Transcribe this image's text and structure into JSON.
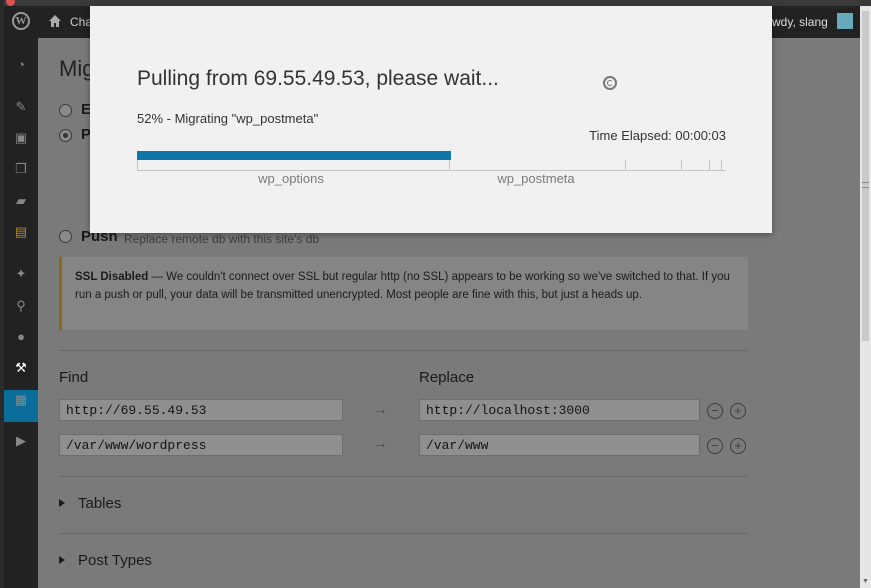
{
  "admin_bar": {
    "site_name": "Cha",
    "howdy": "wdy, slang"
  },
  "page": {
    "title": "Mig"
  },
  "options": [
    {
      "label": "E",
      "description": "",
      "checked": false
    },
    {
      "label": "P",
      "description": "",
      "checked": true
    },
    {
      "label": "Push",
      "description": "Replace remote db with this site's db",
      "checked": false
    }
  ],
  "notice": {
    "title": "SSL Disabled",
    "text": " — We couldn't connect over SSL but regular http (no SSL) appears to be working so we've switched to that. If you run a push or pull, your data will be transmitted unencrypted. Most people are fine with this, but just a heads up."
  },
  "find_replace": {
    "find_label": "Find",
    "replace_label": "Replace",
    "rows": [
      {
        "find": "http://69.55.49.53",
        "replace": "http://localhost:3000"
      },
      {
        "find": "/var/www/wordpress",
        "replace": "/var/www"
      }
    ]
  },
  "sections": [
    "Tables",
    "Post Types"
  ],
  "modal": {
    "title": "Pulling from 69.55.49.53, please wait...",
    "status": "52% - Migrating \"wp_postmeta\"",
    "elapsed": "Time Elapsed: 00:00:03",
    "progress_fraction": 0.533,
    "table_labels": [
      "wp_options",
      "wp_postmeta"
    ]
  },
  "colors": {
    "progress": "#0f76a8",
    "notice_border": "#8a6a10",
    "active_menu": "#0b6e9a"
  },
  "icons": [
    "wordpress-logo-icon",
    "home-icon",
    "dashboard-icon",
    "pin-icon",
    "media-icon",
    "pages-icon",
    "comments-icon",
    "appearance-icon",
    "plugins-icon",
    "users-icon",
    "tools-icon",
    "settings-icon",
    "play-icon",
    "arrow-right-icon",
    "minus-icon",
    "plus-icon",
    "spinner-icon"
  ]
}
